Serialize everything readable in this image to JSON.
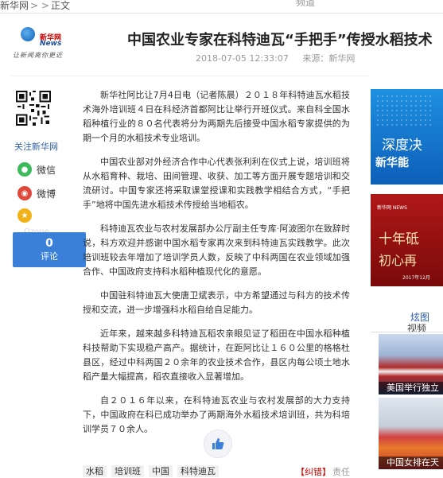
{
  "breadcrumb": {
    "home": "新华网",
    "sep": "> >",
    "current": "正文",
    "right_text": "频道"
  },
  "logo": {
    "brand_cn": "新华网",
    "brand_en": "News",
    "slogan": "让新闻离你更近"
  },
  "article": {
    "title": "中国农业专家在科特迪瓦“手把手”传授水稻技术",
    "datetime": "2018-07-05 12:33:07",
    "source": "来源：新华网",
    "paragraphs": [
      "新华社阿比让7月4日电（记者陈晨）２０１８年科特迪瓦水稻技术海外培训班４日在科经济首都阿比让举行开班仪式。来自科全国水稻种植行业的８０名代表将分为两期先后接受中国水稻专家提供的为期一个月的水稻技术专业培训。",
      "中国农业部对外经济合作中心代表张利利在仪式上说，培训班将从水稻育种、栽培、田间管理、收获、加工等方面开展专题培训和交流研讨。中国专家还将采取课堂授课和实践教学相结合方式，“手把手”地将中国先进水稻技术传授给当地稻农。",
      "科特迪瓦农业与农村发展部办公厅副主任专库·阿波图尔在致辞时说，科方欢迎并感谢中国水稻专家再次来到科特迪瓦实践教学。此次培训班较去年增加了培训学员人数，反映了中科两国在农业领域加强合作、中国政府支持科水稻种植现代化的意愿。",
      "中国驻科特迪瓦大使唐卫斌表示，中方希望通过与科方的技术传授和交流，进一步增强科水稻自给自足能力。",
      "近年来，越来越多科特迪瓦稻农亲眼见证了稻田在中国水稻种植科技帮助下实现稳产高产。据统计，在距阿比让１６０公里的格格杜县区，经过中科两国２０余年的农业技术合作，县区内每公顷土地水稻产量大幅提高，稻农直接收入显著增加。",
      "自２０１６年以来，在科特迪瓦农业与农村发展部的大力支持下，中国政府在科已成功举办了两期海外水稻技术培训班，共为科培训学员７０余人。"
    ],
    "tags": [
      "水稻",
      "培训班",
      "中国",
      "科特迪瓦"
    ],
    "correct_label": "纠错",
    "editor_label": "责任"
  },
  "sidebar": {
    "follow_label": "关注新华网",
    "wechat_label": "微信",
    "weibo_label": "微博",
    "collect_label": "Qzone",
    "comment_count": "0",
    "comment_label": "评论"
  },
  "right_rail": {
    "ad1_line1": "深度决",
    "ad1_line2": "新华能",
    "ad2_logo": "新华网 NEWS",
    "ad2_line1": "十年砥",
    "ad2_line2": "初心再",
    "ad2_date": "2017年12月",
    "photo_tab": "炫图",
    "video_tab": "视频",
    "photo1_caption": "美国举行独立",
    "photo2_caption": "中国女排在天"
  },
  "colors": {
    "accent_blue": "#3a7fd8",
    "link_blue": "#2b5ca8",
    "brand_red": "#c00"
  }
}
